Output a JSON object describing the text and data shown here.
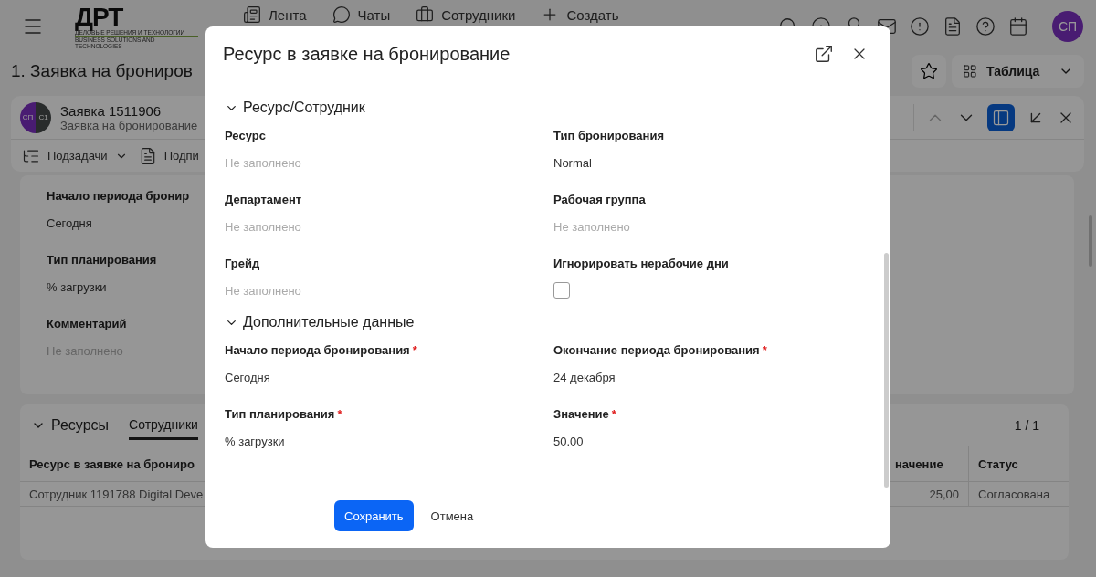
{
  "app": {
    "logo": {
      "mark": "ДРТ",
      "tagline_1": "ДЕЛОВЫЕ РЕШЕНИЯ И ТЕХНОЛОГИИ",
      "tagline_2": "BUSINESS SOLUTIONS AND TECHNOLOGIES"
    },
    "nav": [
      {
        "label": "Лента",
        "kind": "feed"
      },
      {
        "label": "Чаты",
        "kind": "chat"
      },
      {
        "label": "Сотрудники",
        "kind": "people"
      },
      {
        "label": "Создать",
        "kind": "create"
      }
    ],
    "avatar": "СП",
    "page_title": "1. Заявка на брониров",
    "view_select": "Таблица"
  },
  "record": {
    "avatars": [
      "СП",
      "С1"
    ],
    "title": "Заявка 1511906",
    "subtitle": "Заявка на бронирование",
    "panel_view_active": true,
    "toolbar": [
      {
        "label": "Подзадачи",
        "dropdown": true
      },
      {
        "label": "Подпи",
        "dropdown": false
      }
    ]
  },
  "form_fields": [
    {
      "label": "Начало периода бронир",
      "value": "Сегодня",
      "empty": false
    },
    {
      "label": "Тип планирования",
      "value": "% загрузки",
      "empty": false
    },
    {
      "label": "Комментарий",
      "value": "Не заполнено",
      "empty": true
    }
  ],
  "resources": {
    "title": "Ресурсы",
    "tabs": [
      {
        "label": "Сотрудники",
        "selected": true
      }
    ],
    "pager": "1 / 1",
    "columns": [
      "Ресурс в заявке на брониро",
      "начение",
      "Статус"
    ],
    "rows": [
      [
        "Сотрудник 1191788 Digital Deve",
        "25,00",
        "Согласована"
      ]
    ]
  },
  "dialog": {
    "title": "Ресурс в заявке на бронирование",
    "sections": [
      {
        "title": "Ресурс/Сотрудник",
        "expanded": true,
        "fields": [
          {
            "kind": "text",
            "label": "Ресурс",
            "value": "Не заполнено",
            "empty": true
          },
          {
            "kind": "text",
            "label": "Тип бронирования",
            "value": "Normal",
            "empty": false
          },
          {
            "kind": "text",
            "label": "Департамент",
            "value": "Не заполнено",
            "empty": true
          },
          {
            "kind": "text",
            "label": "Рабочая группа",
            "value": "Не заполнено",
            "empty": true
          },
          {
            "kind": "text",
            "label": "Грейд",
            "value": "Не заполнено",
            "empty": true
          },
          {
            "kind": "checkbox",
            "label": "Игнорировать нерабочие дни",
            "checked": false
          }
        ]
      },
      {
        "title": "Дополнительные данные",
        "expanded": true,
        "fields": [
          {
            "kind": "text",
            "label": "Начало периода бронирования",
            "required_mark": "*",
            "value": "Сегодня",
            "empty": false
          },
          {
            "kind": "text",
            "label": "Окончание периода бронирования",
            "required_mark": "*",
            "value": "24 декабря",
            "empty": false
          },
          {
            "kind": "text",
            "label": "Тип планирования",
            "required_mark": "*",
            "value": "% загрузки",
            "empty": false
          },
          {
            "kind": "text",
            "label": "Значение",
            "required_mark": "*",
            "value": "50.00",
            "empty": false
          }
        ]
      }
    ],
    "buttons": [
      {
        "label": "Сохранить",
        "kind": "primary"
      },
      {
        "label": "Отмена",
        "kind": "link"
      }
    ]
  }
}
